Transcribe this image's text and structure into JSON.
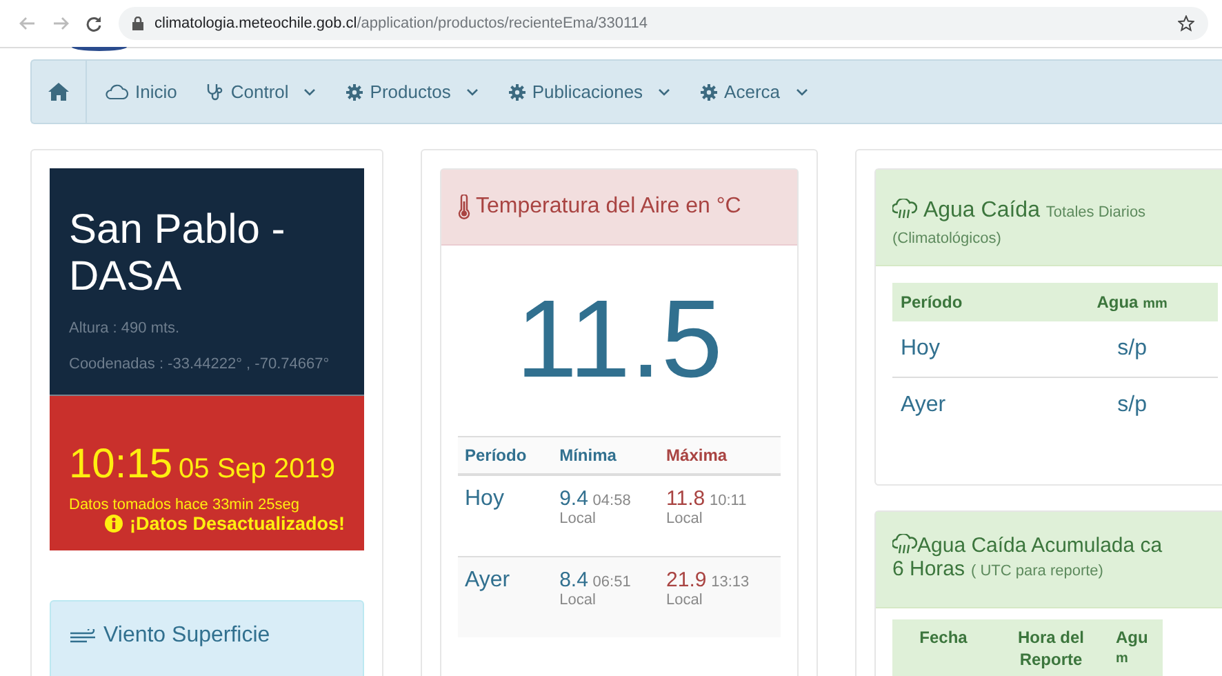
{
  "browser": {
    "url_host": "climatologia.meteochile.gob.cl",
    "url_path": "/application/productos/recienteEma/330114"
  },
  "nav": {
    "items": [
      {
        "kind": "home",
        "dropdown": false
      },
      {
        "kind": "cloud",
        "label": "Inicio",
        "dropdown": false
      },
      {
        "kind": "stethoscope",
        "label": "Control",
        "dropdown": true
      },
      {
        "kind": "gear",
        "label": "Productos",
        "dropdown": true
      },
      {
        "kind": "gear",
        "label": "Publicaciones",
        "dropdown": true
      },
      {
        "kind": "gear",
        "label": "Acerca",
        "dropdown": true
      }
    ]
  },
  "station": {
    "name": "San Pablo - DASA",
    "altitude": "Altura : 490 mts.",
    "coords": "Coodenadas : -33.44222° , -70.74667°",
    "time": "10:15",
    "date": "05 Sep 2019",
    "age": "Datos tomados hace 33min 25seg",
    "stale": true,
    "warning": "¡Datos Desactualizados!"
  },
  "wind": {
    "title": "Viento Superficie"
  },
  "temperature": {
    "title": "Temperatura del Aire en °C",
    "current": "11.5",
    "columns": [
      "Período",
      "Mínima",
      "Máxima"
    ],
    "rows": [
      {
        "period": "Hoy",
        "min": "9.4",
        "min_time": "04:58",
        "min_zone": "Local",
        "max": "11.8",
        "max_time": "10:11",
        "max_zone": "Local"
      },
      {
        "period": "Ayer",
        "min": "8.4",
        "min_time": "06:51",
        "min_zone": "Local",
        "max": "21.9",
        "max_time": "13:13",
        "max_zone": "Local"
      }
    ]
  },
  "rain_daily": {
    "title": "Agua Caída",
    "subtitle": "Totales Diarios",
    "note": "(Climatológicos)",
    "columns": [
      {
        "label": "Período"
      },
      {
        "label": "Agua",
        "unit": "mm"
      }
    ],
    "rows": [
      {
        "period": "Hoy",
        "value": "s/p"
      },
      {
        "period": "Ayer",
        "value": "s/p"
      }
    ]
  },
  "rain_6h": {
    "title": "Agua Caída Acumulada ca",
    "title_2": "6 Horas",
    "note": "( UTC para reporte)",
    "columns": [
      {
        "label": "Fecha"
      },
      {
        "label": "Hora del Reporte"
      },
      {
        "label": "Agu",
        "unit": "m"
      }
    ]
  }
}
